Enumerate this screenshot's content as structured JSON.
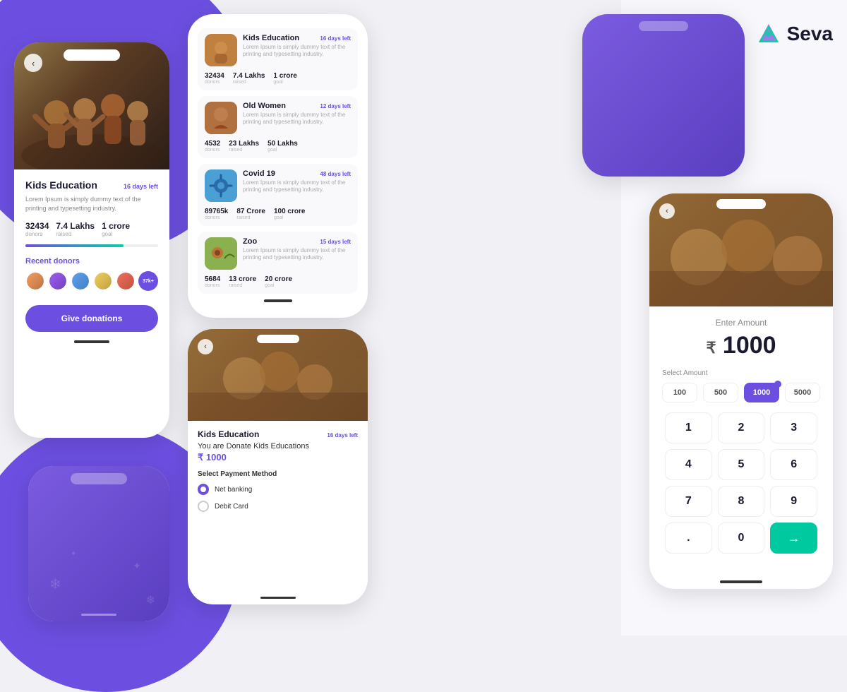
{
  "brand": {
    "name": "Seva",
    "logo_alt": "Seva Logo"
  },
  "phone_detail": {
    "image_alt": "Kids playing",
    "back_label": "‹",
    "title": "Kids Education",
    "days_left": "16 days left",
    "description": "Lorem Ipsum is simply dummy text of the printing and typesetting industry.",
    "stats": [
      {
        "value": "32434",
        "label": "donors"
      },
      {
        "value": "7.4 Lakhs",
        "label": "raised"
      },
      {
        "value": "1 crore",
        "label": "goal"
      }
    ],
    "progress_percent": 74,
    "recent_donors_label": "Recent donors",
    "donor_count_extra": "37k+",
    "give_btn": "Give donations",
    "home_bar": "—"
  },
  "phone_list": {
    "items": [
      {
        "title": "Kids Education",
        "days_left": "16 days left",
        "description": "Lorem Ipsum is simply dummy text of the printing and typesetting industry.",
        "stats": [
          {
            "value": "32434",
            "label": "donors"
          },
          {
            "value": "7.4 Lakhs",
            "label": "raised"
          },
          {
            "value": "1 crore",
            "label": "goal"
          }
        ],
        "thumb_class": "thumb-kids"
      },
      {
        "title": "Old Women",
        "days_left": "12 days left",
        "description": "Lorem Ipsum is simply dummy text of the printing and typesetting industry.",
        "stats": [
          {
            "value": "4532",
            "label": "donors"
          },
          {
            "value": "23 Lakhs",
            "label": "raised"
          },
          {
            "value": "50 Lakhs",
            "label": "goal"
          }
        ],
        "thumb_class": "thumb-women"
      },
      {
        "title": "Covid 19",
        "days_left": "48 days left",
        "description": "Lorem Ipsum is simply dummy text of the printing and typesetting industry.",
        "stats": [
          {
            "value": "89765k",
            "label": "donors"
          },
          {
            "value": "87 Crore",
            "label": "raised"
          },
          {
            "value": "100 crore",
            "label": "goal"
          }
        ],
        "thumb_class": "thumb-covid"
      },
      {
        "title": "Zoo",
        "days_left": "15 days left",
        "description": "Lorem Ipsum is simply dummy text of the printing and typesetting industry.",
        "stats": [
          {
            "value": "5684",
            "label": "donors"
          },
          {
            "value": "13 crore",
            "label": "raised"
          },
          {
            "value": "20 crore",
            "label": "goal"
          }
        ],
        "thumb_class": "thumb-zoo"
      }
    ]
  },
  "phone_payment": {
    "back_label": "‹",
    "title": "Kids Education",
    "days_left": "16 days left",
    "donate_text": "You are Donate Kids Educations",
    "amount": "₹ 1000",
    "select_method_label": "Select Payment Method",
    "methods": [
      {
        "label": "Net banking",
        "selected": true
      },
      {
        "label": "Debit Card",
        "selected": false
      }
    ]
  },
  "phone_amount": {
    "back_label": "‹",
    "enter_label": "Enter Amount",
    "currency_symbol": "₹",
    "amount": "1000",
    "select_amount_label": "Select Amount",
    "chips": [
      {
        "value": "100",
        "active": false
      },
      {
        "value": "500",
        "active": false
      },
      {
        "value": "1000",
        "active": true
      },
      {
        "value": "5000",
        "active": false
      }
    ],
    "numpad": [
      "1",
      "2",
      "3",
      "4",
      "5",
      "6",
      "7",
      "8",
      "9",
      ".",
      "0",
      "→"
    ]
  }
}
